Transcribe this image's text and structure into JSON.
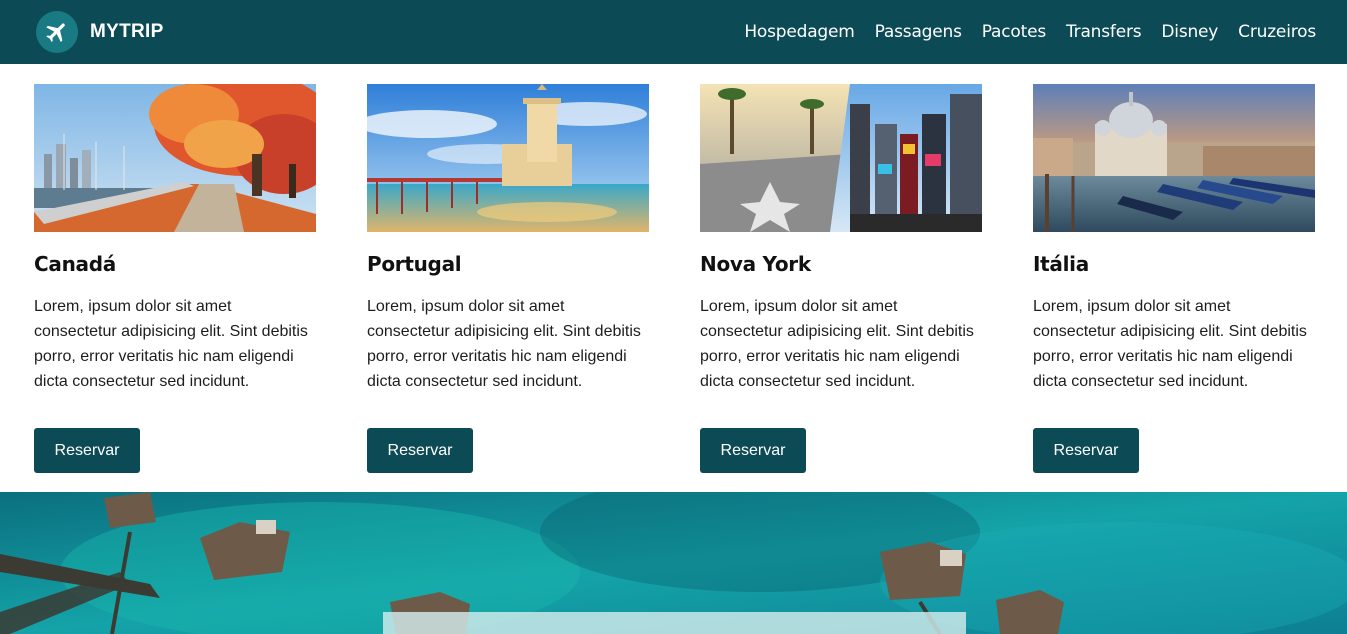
{
  "brand": {
    "name": "MYTRIP",
    "logo_icon": "airplane-icon"
  },
  "nav": {
    "items": [
      "Hospedagem",
      "Passagens",
      "Pacotes",
      "Transfers",
      "Disney",
      "Cruzeiros"
    ]
  },
  "cards": [
    {
      "title": "Canadá",
      "text": "Lorem, ipsum dolor sit amet consectetur adipisicing elit. Sint debitis porro, error veritatis hic nam eligendi dicta consectetur sed incidunt.",
      "button": "Reservar"
    },
    {
      "title": "Portugal",
      "text": "Lorem, ipsum dolor sit amet consectetur adipisicing elit. Sint debitis porro, error veritatis hic nam eligendi dicta consectetur sed incidunt.",
      "button": "Reservar"
    },
    {
      "title": "Nova York",
      "text": "Lorem, ipsum dolor sit amet consectetur adipisicing elit. Sint debitis porro, error veritatis hic nam eligendi dicta consectetur sed incidunt.",
      "button": "Reservar"
    },
    {
      "title": "Itália",
      "text": "Lorem, ipsum dolor sit amet consectetur adipisicing elit. Sint debitis porro, error veritatis hic nam eligendi dicta consectetur sed incidunt.",
      "button": "Reservar"
    }
  ],
  "colors": {
    "primary": "#0c4b55",
    "logo_badge": "#1a7a84",
    "white": "#ffffff"
  }
}
